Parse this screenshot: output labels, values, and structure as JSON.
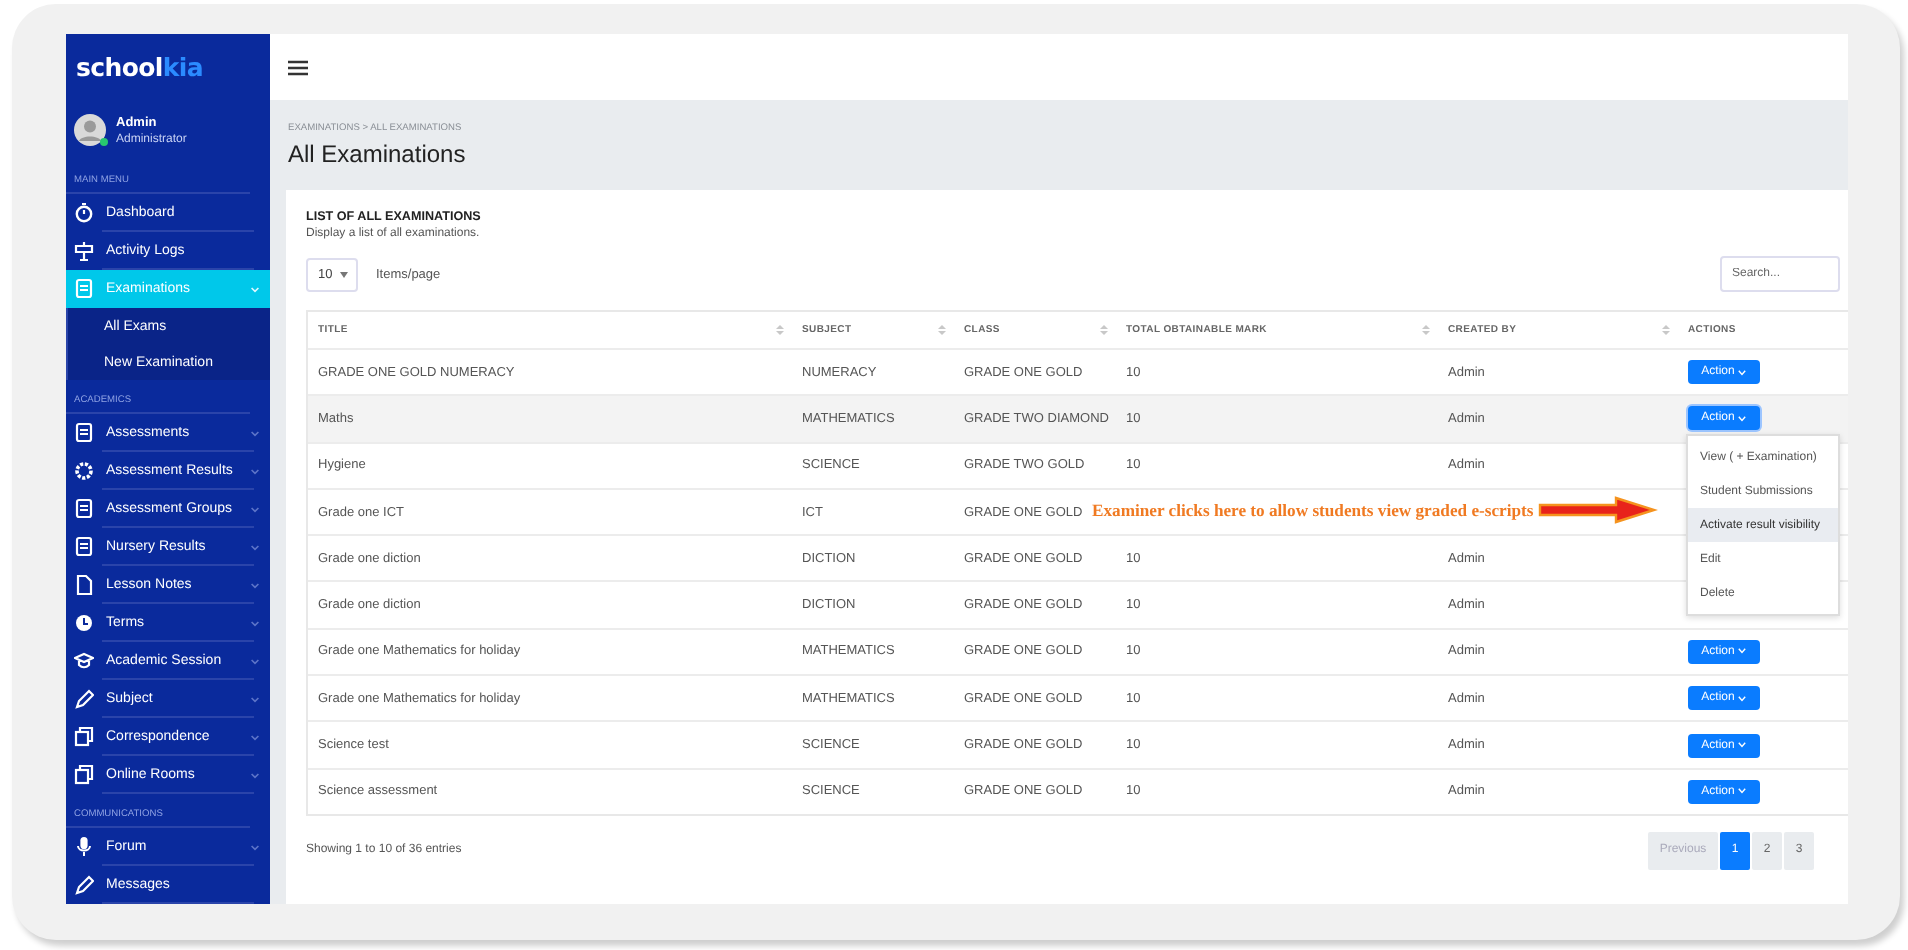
{
  "sidebar": {
    "logo": {
      "text": "school",
      "accent": "kia"
    },
    "user": {
      "name": "Admin",
      "role": "Administrator",
      "online": true
    },
    "sections": [
      {
        "label": "MAIN MENU",
        "items": [
          {
            "label": "Dashboard",
            "kind": "stopwatch",
            "expandable": false,
            "selected": false
          },
          {
            "label": "Activity Logs",
            "kind": "sign",
            "expandable": false,
            "selected": false
          },
          {
            "label": "Examinations",
            "kind": "doc",
            "expandable": true,
            "selected": true,
            "children": [
              {
                "label": "All Exams"
              },
              {
                "label": "New Examination"
              }
            ]
          }
        ]
      },
      {
        "label": "ACADEMICS",
        "items": [
          {
            "label": "Assessments",
            "kind": "doc",
            "expandable": true,
            "selected": false
          },
          {
            "label": "Assessment Results",
            "kind": "cog",
            "expandable": true,
            "selected": false
          },
          {
            "label": "Assessment Groups",
            "kind": "doc",
            "expandable": true,
            "selected": false
          },
          {
            "label": "Nursery Results",
            "kind": "doc",
            "expandable": true,
            "selected": false
          },
          {
            "label": "Lesson Notes",
            "kind": "file",
            "expandable": true,
            "selected": false
          },
          {
            "label": "Terms",
            "kind": "clock",
            "expandable": true,
            "selected": false
          },
          {
            "label": "Academic Session",
            "kind": "cap",
            "expandable": true,
            "selected": false
          },
          {
            "label": "Subject",
            "kind": "pencil",
            "expandable": true,
            "selected": false
          },
          {
            "label": "Correspondence",
            "kind": "copy",
            "expandable": true,
            "selected": false
          },
          {
            "label": "Online Rooms",
            "kind": "copy",
            "expandable": true,
            "selected": false
          }
        ]
      },
      {
        "label": "COMMUNICATIONS",
        "items": [
          {
            "label": "Forum",
            "kind": "mic",
            "expandable": true,
            "selected": false
          },
          {
            "label": "Messages",
            "kind": "pencil",
            "expandable": false,
            "selected": false
          }
        ]
      }
    ]
  },
  "main": {
    "breadcrumb": "EXAMINATIONS > ALL EXAMINATIONS",
    "title": "All Examinations",
    "card": {
      "title": "LIST OF ALL EXAMINATIONS",
      "subtitle": "Display a list of all examinations.",
      "page_size": "10",
      "page_size_label": "Items/page",
      "search": {
        "placeholder": "Search..."
      }
    },
    "table": {
      "columns": [
        {
          "label": "TITLE",
          "sortable": true
        },
        {
          "label": "SUBJECT",
          "sortable": true
        },
        {
          "label": "CLASS",
          "sortable": true
        },
        {
          "label": "TOTAL OBTAINABLE MARK",
          "sortable": true
        },
        {
          "label": "CREATED BY",
          "sortable": true
        },
        {
          "label": "ACTIONS",
          "sortable": false
        }
      ],
      "rows": [
        {
          "title": "GRADE ONE GOLD NUMERACY",
          "subject": "NUMERACY",
          "class": "GRADE ONE GOLD",
          "mark": "10",
          "created_by": "Admin",
          "action": "Action",
          "selected": false
        },
        {
          "title": "Maths",
          "subject": "MATHEMATICS",
          "class": "GRADE TWO DIAMOND",
          "mark": "10",
          "created_by": "Admin",
          "action": "Action",
          "selected": true
        },
        {
          "title": "Hygiene",
          "subject": "SCIENCE",
          "class": "GRADE TWO GOLD",
          "mark": "10",
          "created_by": "Admin",
          "selected": false
        },
        {
          "title": "Grade one ICT",
          "subject": "ICT",
          "class": "GRADE ONE GOLD",
          "selected": false
        },
        {
          "title": "Grade one diction",
          "subject": "DICTION",
          "class": "GRADE ONE GOLD",
          "mark": "10",
          "created_by": "Admin",
          "selected": false
        },
        {
          "title": "Grade one diction",
          "subject": "DICTION",
          "class": "GRADE ONE GOLD",
          "mark": "10",
          "created_by": "Admin",
          "selected": false
        },
        {
          "title": "Grade one Mathematics for holiday",
          "subject": "MATHEMATICS",
          "class": "GRADE ONE GOLD",
          "mark": "10",
          "created_by": "Admin",
          "action": "Action",
          "selected": false
        },
        {
          "title": "Grade one Mathematics for holiday",
          "subject": "MATHEMATICS",
          "class": "GRADE ONE GOLD",
          "mark": "10",
          "created_by": "Admin",
          "action": "Action",
          "selected": false
        },
        {
          "title": "Science test",
          "subject": "SCIENCE",
          "class": "GRADE ONE GOLD",
          "mark": "10",
          "created_by": "Admin",
          "action": "Action",
          "selected": false
        },
        {
          "title": "Science assessment",
          "subject": "SCIENCE",
          "class": "GRADE ONE GOLD",
          "mark": "10",
          "created_by": "Admin",
          "action": "Action",
          "selected": false
        }
      ]
    },
    "action_menu": {
      "items": [
        {
          "label": "View ( + Examination)",
          "selected": false
        },
        {
          "label": "Student Submissions",
          "selected": false
        },
        {
          "label": "Activate result visibility",
          "selected": true
        },
        {
          "label": "Edit",
          "selected": false
        },
        {
          "label": "Delete",
          "selected": false
        }
      ]
    },
    "annotation": "Examiner clicks here to allow students view graded e-scripts",
    "footer": "Showing 1 to 10 of 36 entries",
    "pagination": [
      {
        "label": "Previous",
        "disabled": true,
        "selected": false
      },
      {
        "label": "1",
        "disabled": false,
        "selected": true
      },
      {
        "label": "2",
        "disabled": false,
        "selected": false
      },
      {
        "label": "3",
        "disabled": false,
        "selected": false
      }
    ]
  }
}
